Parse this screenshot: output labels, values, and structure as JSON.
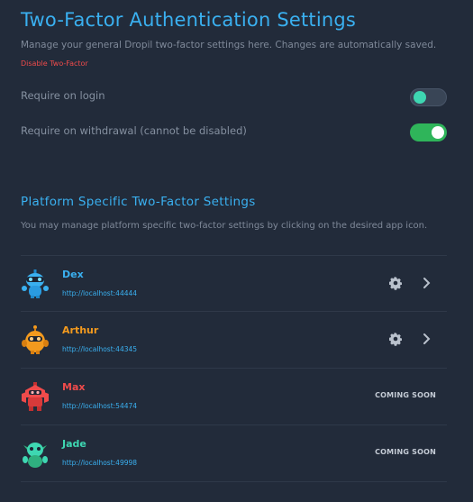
{
  "header": {
    "title": "Two-Factor Authentication Settings",
    "subtitle": "Manage your general Dropil two-factor settings here. Changes are automatically saved.",
    "disable_link": "Disable Two-Factor"
  },
  "settings": [
    {
      "label": "Require on login",
      "enabled": false
    },
    {
      "label": "Require on withdrawal (cannot be disabled)",
      "enabled": true
    }
  ],
  "platform": {
    "title": "Platform Specific Two-Factor Settings",
    "subtitle": "You may manage platform specific two-factor settings by clicking on the desired app icon.",
    "apps": [
      {
        "name": "Dex",
        "url": "http://localhost:44444",
        "color": "#3ab0f0",
        "icon": "robot-blue-icon",
        "status": ""
      },
      {
        "name": "Arthur",
        "url": "http://localhost:44345",
        "color": "#f39a1e",
        "icon": "robot-orange-icon",
        "status": ""
      },
      {
        "name": "Max",
        "url": "http://localhost:54474",
        "color": "#ef4b4b",
        "icon": "robot-red-icon",
        "status": "COMING SOON"
      },
      {
        "name": "Jade",
        "url": "http://localhost:49998",
        "color": "#3ed7b2",
        "icon": "robot-green-icon",
        "status": "COMING SOON"
      }
    ]
  },
  "colors": {
    "background": "#222b3a",
    "accent": "#3ab0f0",
    "danger": "#ef4b4b",
    "toggle_on": "#2fb55a"
  }
}
